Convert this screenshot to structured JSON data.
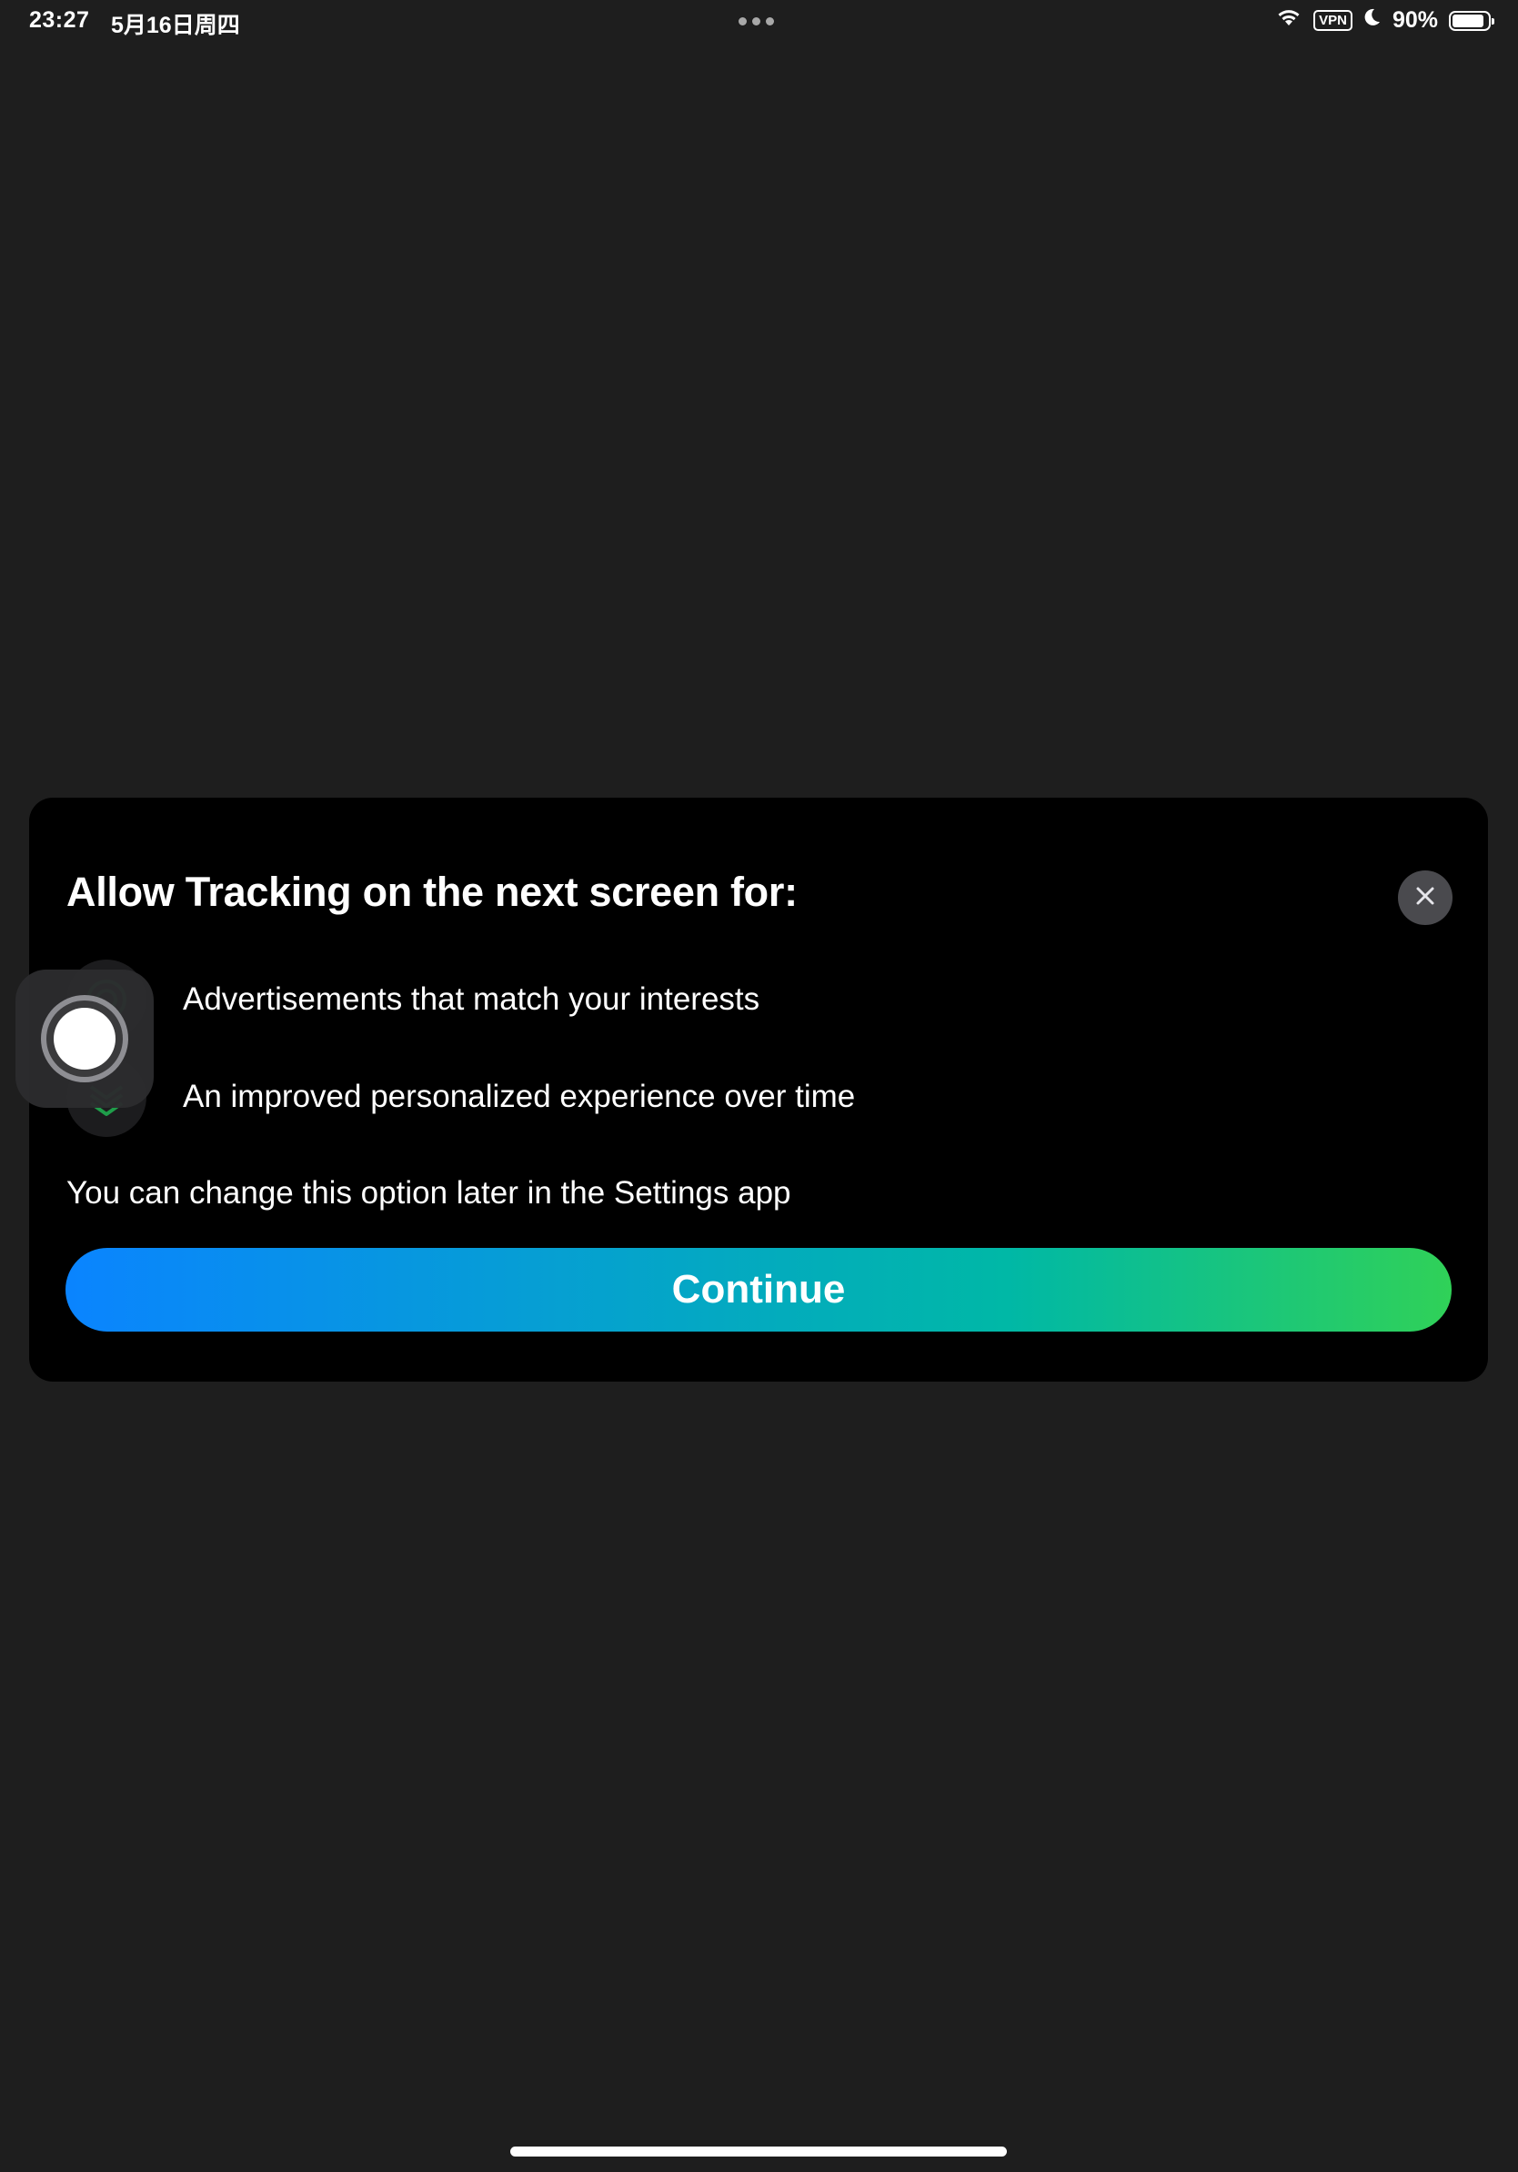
{
  "status_bar": {
    "time": "23:27",
    "date": "5月16日周四",
    "vpn": "VPN",
    "battery_percent": "90%",
    "battery_level": 0.9
  },
  "modal": {
    "title": "Allow Tracking on the next screen for:",
    "close_icon": "close-icon",
    "features": [
      {
        "icon": "target-icon",
        "text": "Advertisements that match your interests"
      },
      {
        "icon": "layers-chevron-icon",
        "text": "An improved personalized experience over time"
      }
    ],
    "note": "You can change this option later in the Settings app",
    "continue_label": "Continue"
  },
  "colors": {
    "background": "#1e1e1e",
    "card": "#000000",
    "gradient_start": "#0a84ff",
    "gradient_mid": "#00b8a6",
    "gradient_end": "#30d158",
    "icon_green": "#1f9d4a"
  }
}
